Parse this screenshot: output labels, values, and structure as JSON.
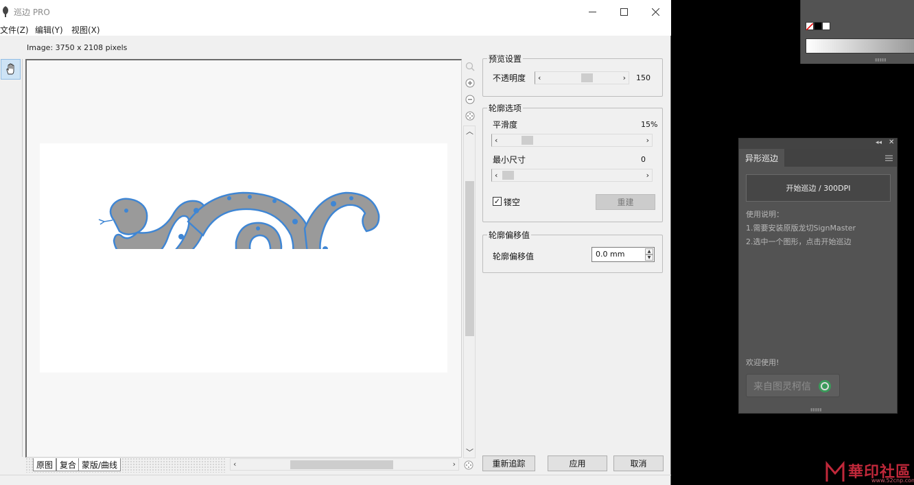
{
  "app": {
    "title": "巡边 PRO",
    "menu": [
      "文件(Z)",
      "编辑(Y)",
      "视图(X)"
    ],
    "image_info": "Image: 3750 x 2108 pixels"
  },
  "window_controls": {
    "minimize": "—",
    "maximize": "☐",
    "close": "✕"
  },
  "canvas": {
    "tabs": [
      "原图",
      "复合",
      "蒙版/曲线"
    ],
    "vertical_scroll_fraction": 0.47,
    "horizontal_scroll_fraction": 0.5
  },
  "preview": {
    "group_title": "预览设置",
    "opacity_label": "不透明度",
    "opacity_value": "150"
  },
  "contour": {
    "group_title": "轮廓选项",
    "smooth_label": "平滑度",
    "smooth_value": "15%",
    "min_size_label": "最小尺寸",
    "min_size_value": "0",
    "hollow_label": "镂空",
    "hollow_checked": true,
    "rebuild_label": "重建"
  },
  "offset": {
    "group_title": "轮廓偏移值",
    "label": "轮廓偏移值",
    "value": "0.0 mm"
  },
  "buttons": {
    "retrace": "重新追踪",
    "apply": "应用",
    "cancel": "取消"
  },
  "plugin": {
    "tab": "异形巡边",
    "start_button": "开始巡边 / 300DPI",
    "instructions_title": "使用说明：",
    "step1": "1.需要安装原版龙切SignMaster",
    "step2": "2.选中一个图形，点击开始巡边",
    "welcome": "欢迎使用!",
    "from": "来自图灵柯信"
  },
  "watermark": {
    "text": "華印社區",
    "sub": "www.52cnp.com"
  },
  "colors": {
    "accent_blue": "#4a8fd6",
    "snake_gray": "#9a9a9a"
  }
}
